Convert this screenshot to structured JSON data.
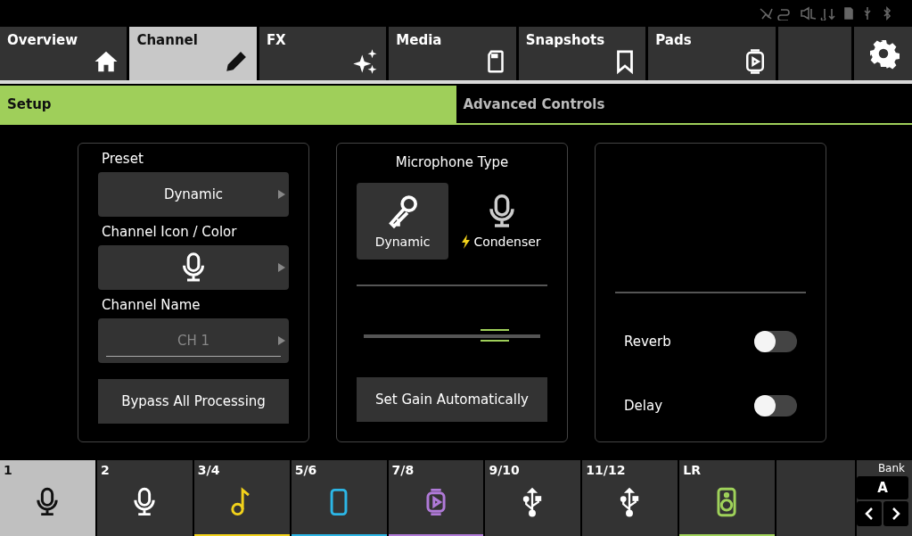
{
  "tabs": [
    {
      "label": "Overview",
      "selected": false
    },
    {
      "label": "Channel",
      "selected": true
    },
    {
      "label": "FX",
      "selected": false
    },
    {
      "label": "Media",
      "selected": false
    },
    {
      "label": "Snapshots",
      "selected": false
    },
    {
      "label": "Pads",
      "selected": false
    }
  ],
  "subtabs": [
    {
      "label": "Setup",
      "selected": true
    },
    {
      "label": "Advanced Controls",
      "selected": false
    }
  ],
  "setup": {
    "preset_label": "Preset",
    "preset_value": "Dynamic",
    "icon_label": "Channel Icon / Color",
    "name_label": "Channel Name",
    "name_value": "CH 1",
    "bypass_button": "Bypass All Processing"
  },
  "mic": {
    "title": "Microphone Type",
    "options": [
      {
        "label": "Dynamic",
        "kind": "dynamic",
        "selected": true
      },
      {
        "label": "Condenser",
        "kind": "condenser",
        "selected": false
      }
    ],
    "gain": {
      "level": 0.74
    },
    "auto_gain_button": "Set Gain Automatically"
  },
  "sends": [
    {
      "label": "Reverb",
      "on": false
    },
    {
      "label": "Delay",
      "on": false
    }
  ],
  "channels": [
    {
      "label": "1",
      "kind": "mic",
      "selected": true
    },
    {
      "label": "2",
      "kind": "mic",
      "selected": false
    },
    {
      "label": "3/4",
      "kind": "note",
      "color": "#f2d21b",
      "selected": false
    },
    {
      "label": "5/6",
      "kind": "phone",
      "color": "#2cb6e6",
      "selected": false
    },
    {
      "label": "7/8",
      "kind": "pad",
      "color": "#b07ad8",
      "selected": false
    },
    {
      "label": "9/10",
      "kind": "usb",
      "selected": false
    },
    {
      "label": "11/12",
      "kind": "usb",
      "selected": false
    },
    {
      "label": "LR",
      "kind": "speaker",
      "color": "#9fd25a",
      "selected": false
    }
  ],
  "bank": {
    "label": "Bank",
    "value": "A"
  }
}
